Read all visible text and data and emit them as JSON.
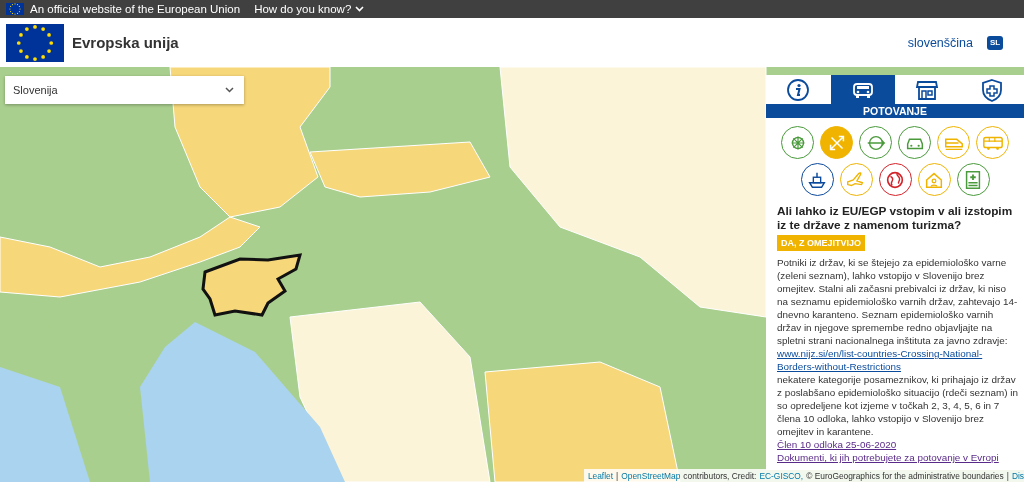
{
  "top_bar": {
    "notice": "An official website of the European Union",
    "how_link": "How do you know?"
  },
  "header": {
    "title": "Evropska unija",
    "language": "slovenščina",
    "language_code": "SL"
  },
  "country_select": {
    "value": "Slovenija"
  },
  "panel": {
    "tabs": [
      {
        "selected": false
      },
      {
        "selected": true
      },
      {
        "selected": false
      },
      {
        "selected": false
      }
    ],
    "section_title": "POTOVANJE",
    "topics": [
      {
        "color": "#4a9a3c",
        "selected": false
      },
      {
        "color": "#f0b400",
        "selected": true
      },
      {
        "color": "#4a9a3c",
        "selected": false
      },
      {
        "color": "#4a9a3c",
        "selected": false
      },
      {
        "color": "#f0b400",
        "selected": false
      },
      {
        "color": "#f0b400",
        "selected": false
      },
      {
        "color": "#0c4a9c",
        "selected": false
      },
      {
        "color": "#f0b400",
        "selected": false
      },
      {
        "color": "#d2232a",
        "selected": false
      },
      {
        "color": "#f0b400",
        "selected": false
      },
      {
        "color": "#4a9a3c",
        "selected": false
      }
    ],
    "question": "Ali lahko iz EU/EGP vstopim v ali izstopim iz te države z namenom turizma?",
    "answer": "DA, Z OMEJITVIJO",
    "body_before": "Potniki iz držav, ki se štejejo za epidemiološko varne (zeleni seznam), lahko vstopijo v Slovenijo brez omejitev. Stalni ali začasni prebivalci iz držav, ki niso na seznamu epidemiološko varnih držav, zahtevajo 14-dnevno karanteno. Seznam epidemiološko varnih držav in njegove spremembe redno objavljajte na spletni strani nacionalnega inštituta za javno zdravje: ",
    "body_link": "www.nijz.si/en/list-countries-Crossing-National-Borders-without-Restrictions",
    "body_after": " nekatere kategorije posameznikov, ki prihajajo iz držav z poslabšano epidemiološko situacijo (rdeči seznam) in so opredeljene kot izjeme v točkah 2, 3, 4, 5, 6 in 7 člena 10 odloka, lahko vstopijo v Slovenijo brez omejitev in karantene.",
    "links": [
      "Člen 10 odloka 25-06-2020",
      "Dokumenti, ki jih potrebujete za potovanje v Evropi"
    ]
  },
  "attribution": [
    {
      "text": "Leaflet",
      "link": true
    },
    {
      "text": "|",
      "link": false
    },
    {
      "text": "OpenStreetMap",
      "link": true
    },
    {
      "text": "contributors, Credit:",
      "link": false
    },
    {
      "text": "EC-GISCO,",
      "link": true
    },
    {
      "text": "© EuroGeographics for the administrative boundaries",
      "link": false
    },
    {
      "text": "|",
      "link": false
    },
    {
      "text": "Dis",
      "link": true
    }
  ]
}
